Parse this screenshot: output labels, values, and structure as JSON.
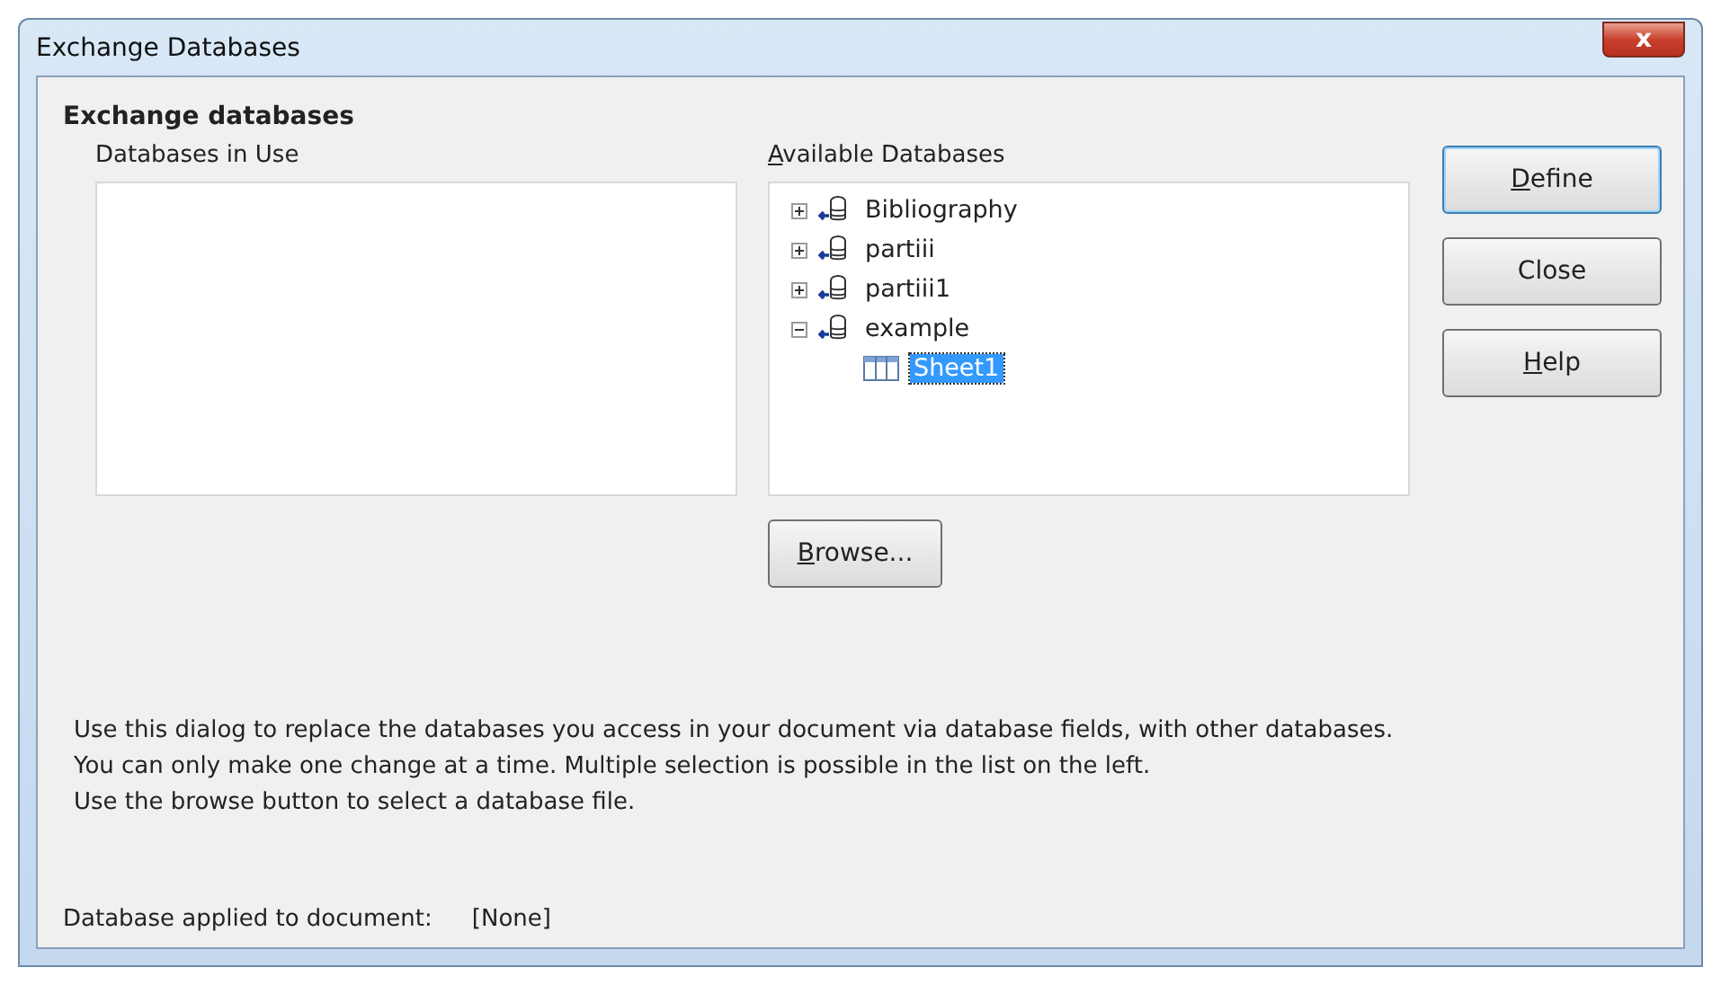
{
  "window": {
    "title": "Exchange Databases",
    "close_symbol": "x"
  },
  "section_title": "Exchange databases",
  "databases_in_use": {
    "label": "Databases in Use"
  },
  "available_databases": {
    "label": "Available Databases",
    "mnemonic": true,
    "items": [
      {
        "label": "Bibliography",
        "expanded": false,
        "selected": false
      },
      {
        "label": "partiii",
        "expanded": false,
        "selected": false
      },
      {
        "label": "partiii1",
        "expanded": false,
        "selected": false
      },
      {
        "label": "example",
        "expanded": true,
        "selected": false,
        "children": [
          {
            "label": "Sheet1",
            "selected": true
          }
        ]
      }
    ]
  },
  "browse_button": {
    "label": "Browse...",
    "mnemonic": true
  },
  "buttons": [
    {
      "label": "Define",
      "mnemonic": true,
      "default": true
    },
    {
      "label": "Close",
      "mnemonic": false,
      "default": false
    },
    {
      "label": "Help",
      "mnemonic": true,
      "default": false
    }
  ],
  "description": [
    "Use this dialog to replace the databases you access in your document via database fields, with other databases. You can only make one change at a time. Multiple selection is possible in the list on the left.",
    "Use the browse button to select a database file."
  ],
  "status": {
    "label": "Database applied to document:",
    "value": "[None]"
  }
}
